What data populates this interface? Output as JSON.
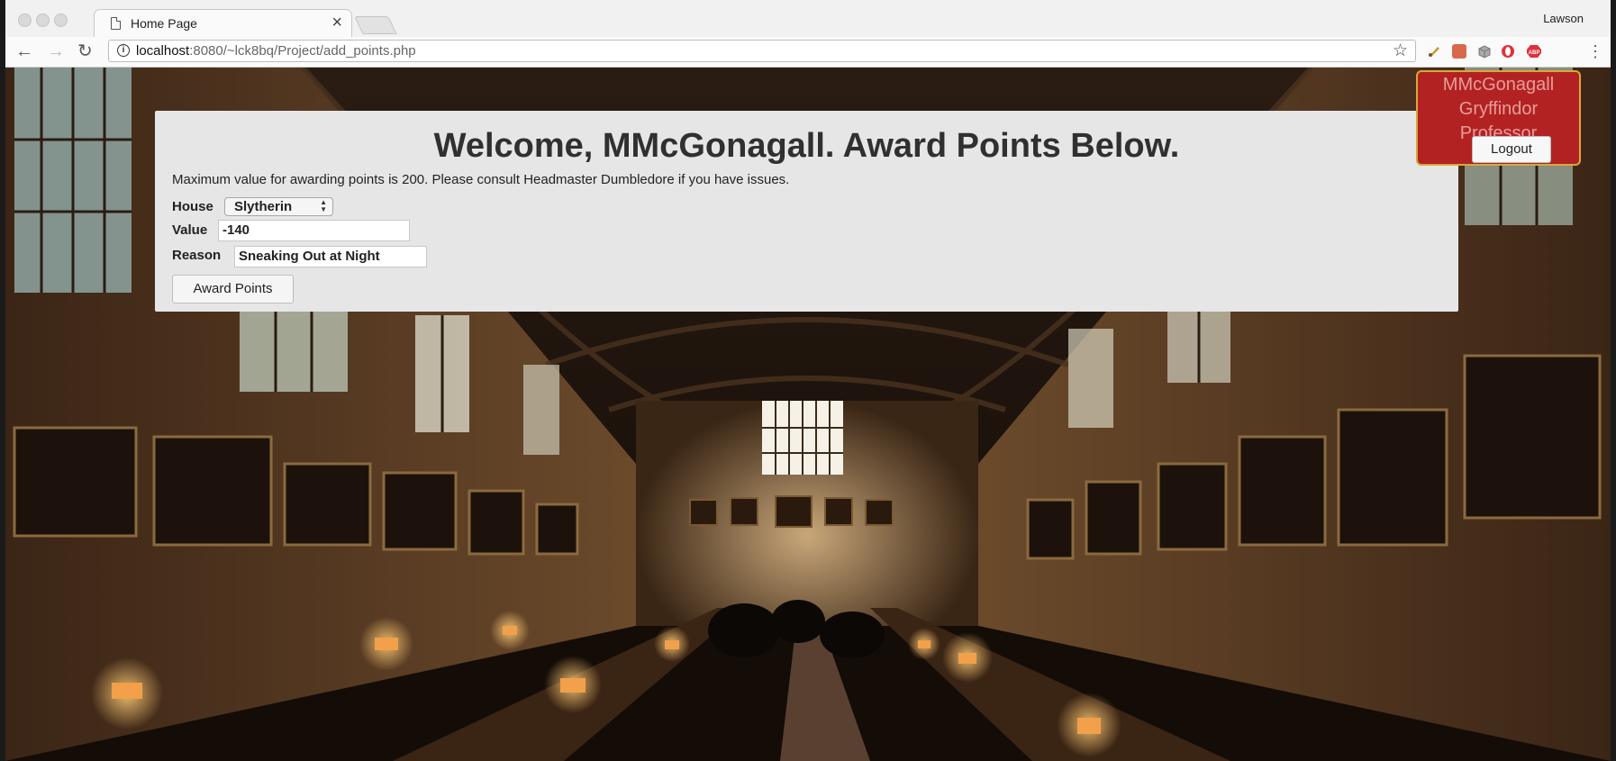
{
  "browser": {
    "tab_title": "Home Page",
    "tab_close_glyph": "×",
    "profile_name": "Lawson",
    "url_host": "localhost",
    "url_rest": ":8080/~lck8bq/Project/add_points.php",
    "nav": {
      "back": "←",
      "forward": "→",
      "reload": "↻"
    },
    "star_glyph": "☆",
    "menu_glyph": "⋮",
    "extensions": [
      "paint-icon",
      "bookmark-icon",
      "box-icon",
      "opera-icon",
      "adblock-icon"
    ]
  },
  "page": {
    "heading": "Welcome, MMcGonagall. Award Points Below.",
    "notice": "Maximum value for awarding points is 200. Please consult Headmaster Dumbledore if you have issues.",
    "form": {
      "house_label": "House",
      "house_value": "Slytherin",
      "value_label": "Value",
      "value_value": "-140",
      "reason_label": "Reason",
      "reason_value": "Sneaking Out at Night",
      "submit_label": "Award Points"
    },
    "user": {
      "name": "MMcGonagall",
      "house": "Gryffindor",
      "role": "Professor",
      "logout_label": "Logout"
    }
  },
  "colors": {
    "user_box_bg": "#b32222",
    "user_box_border": "#d6a93a",
    "panel_bg": "#e6e6e6"
  }
}
